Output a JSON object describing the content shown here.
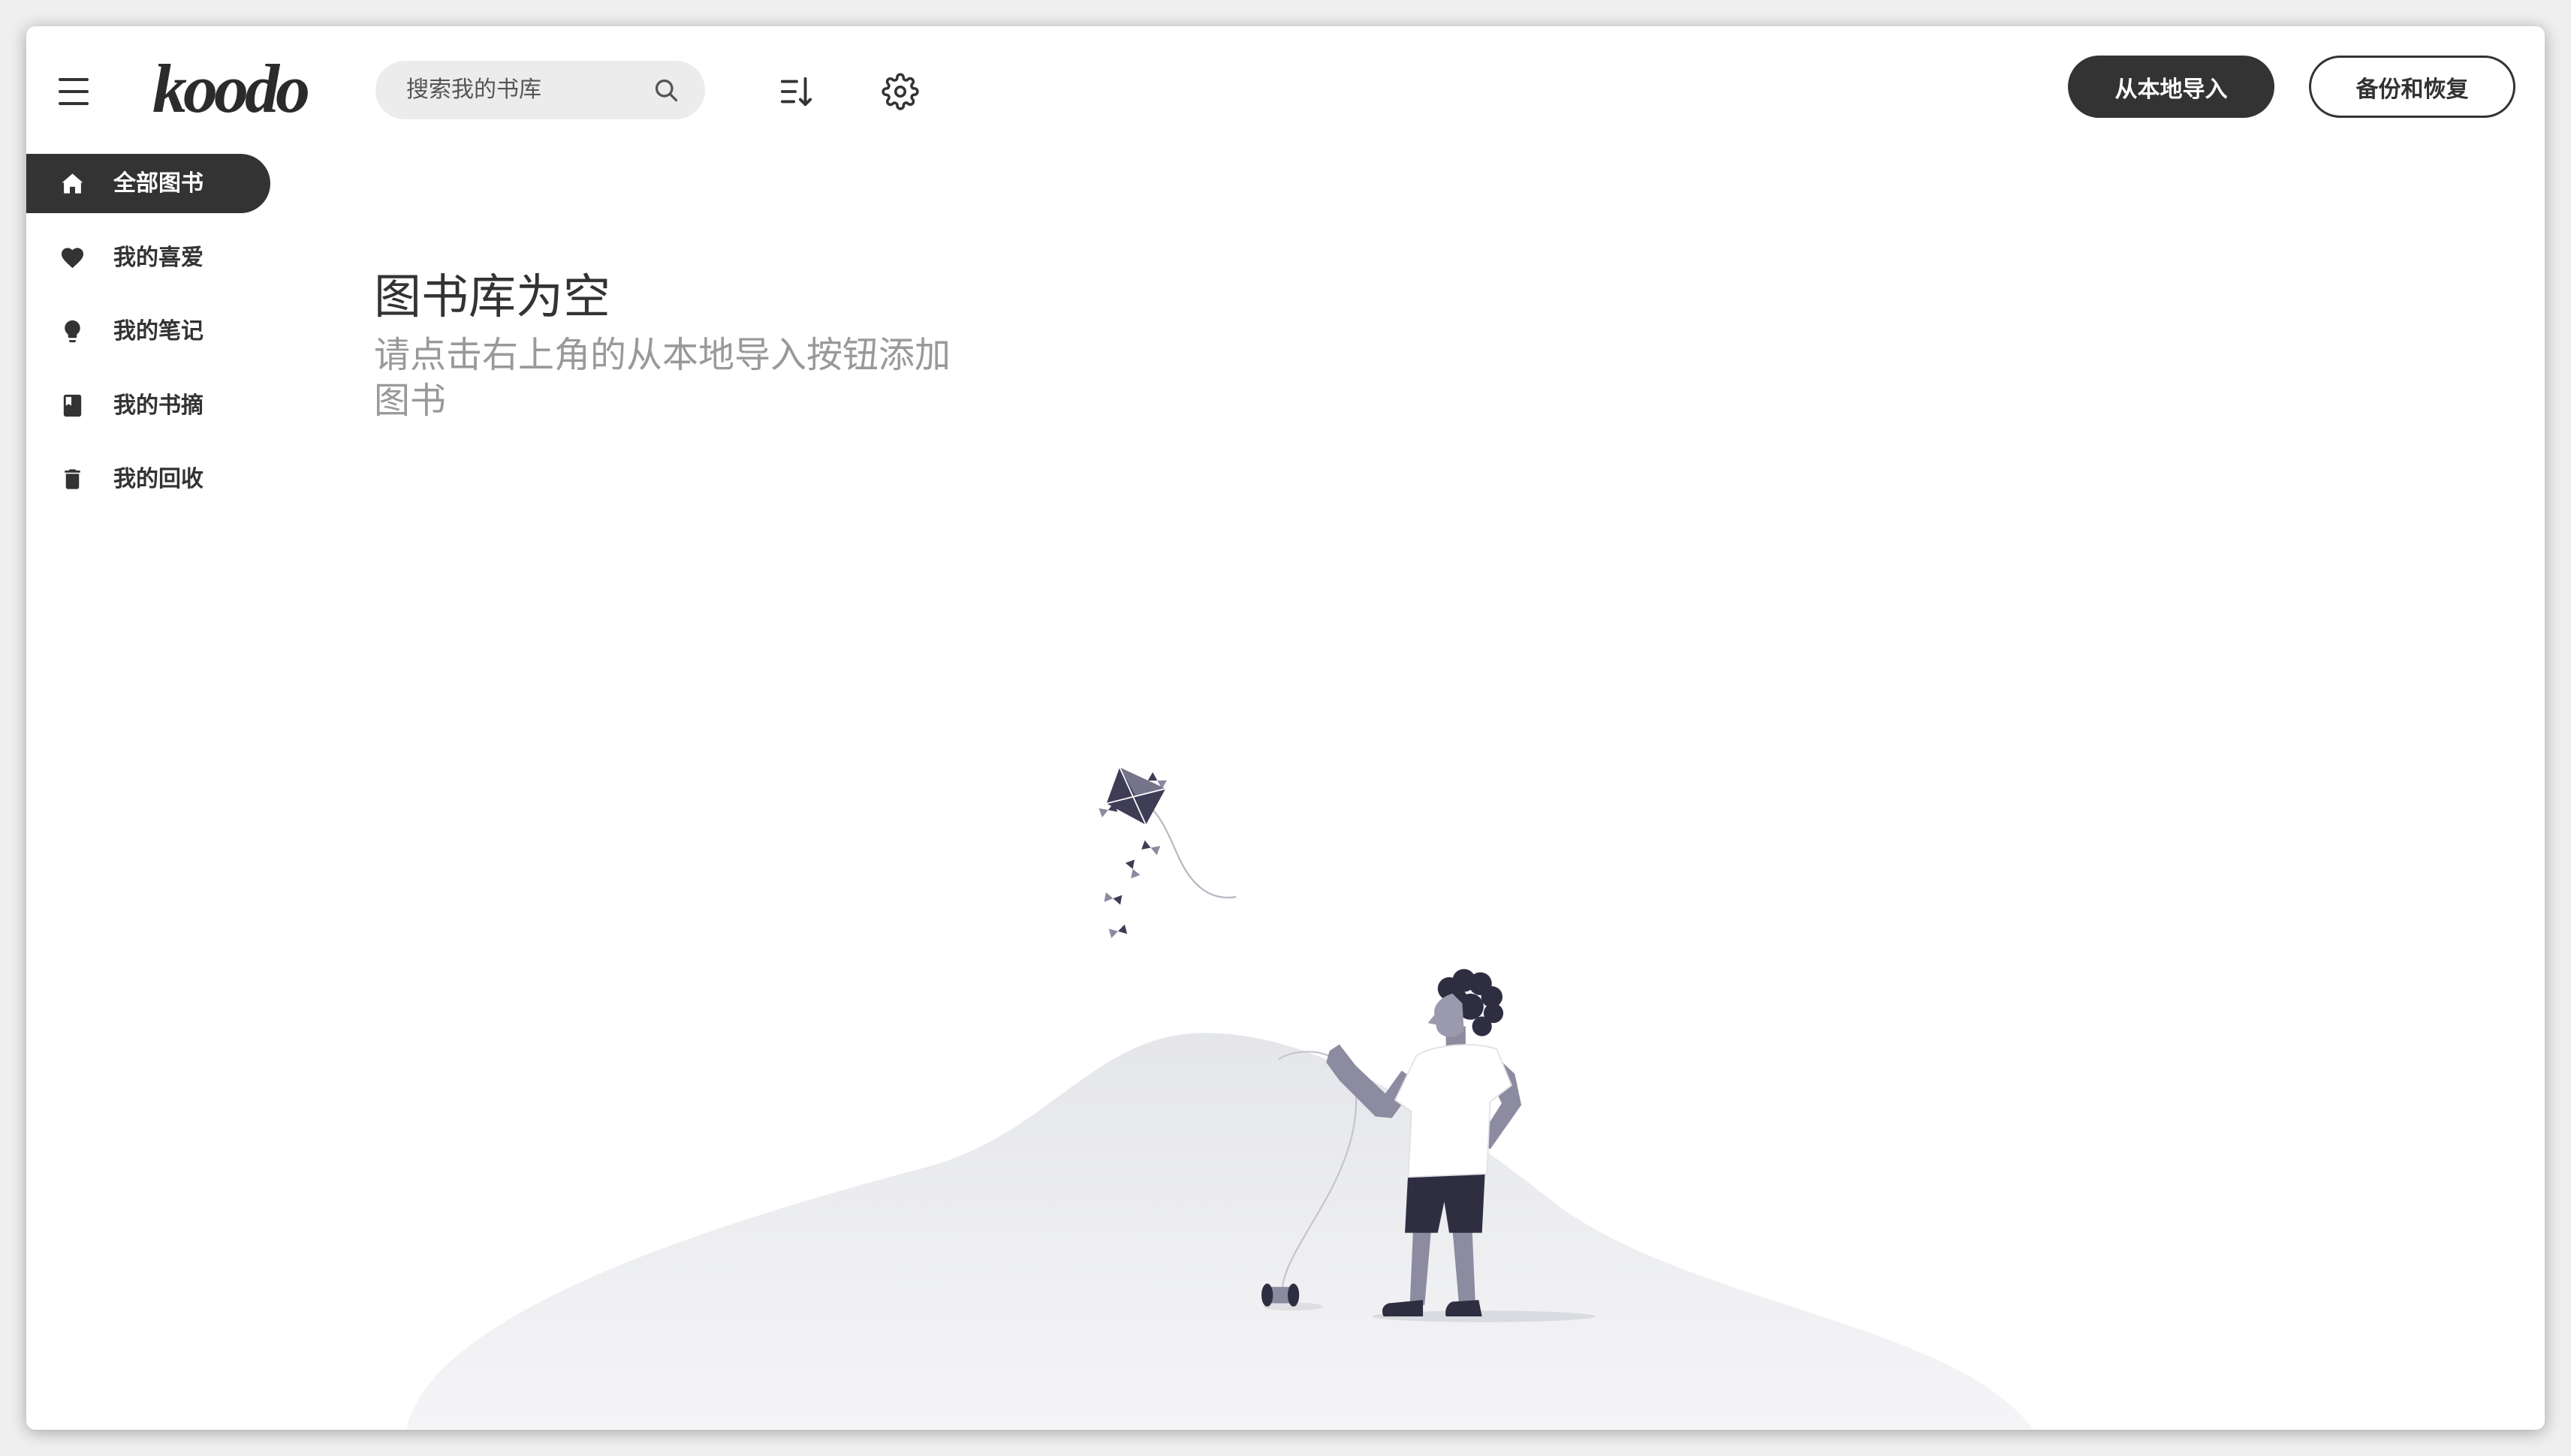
{
  "app": {
    "logo_text": "koodo"
  },
  "header": {
    "menu_icon": "menu-icon",
    "search": {
      "placeholder": "搜索我的书库",
      "icon": "search-icon"
    },
    "sort_icon": "sort-icon",
    "settings_icon": "settings-icon",
    "import_button": {
      "label": "从本地导入"
    },
    "backup_button": {
      "label": "备份和恢复"
    }
  },
  "sidebar": {
    "items": [
      {
        "label": "全部图书",
        "icon": "home-icon",
        "active": true
      },
      {
        "label": "我的喜爱",
        "icon": "heart-icon",
        "active": false
      },
      {
        "label": "我的笔记",
        "icon": "lightbulb-icon",
        "active": false
      },
      {
        "label": "我的书摘",
        "icon": "book-icon",
        "active": false
      },
      {
        "label": "我的回收",
        "icon": "trash-icon",
        "active": false
      }
    ]
  },
  "empty_state": {
    "title": "图书库为空",
    "message": "请点击右上角的从本地导入按钮添加图书"
  },
  "colors": {
    "accent": "#333333",
    "accent_text": "#ffffff",
    "search_background": "#ececec",
    "muted_text": "#999999"
  }
}
